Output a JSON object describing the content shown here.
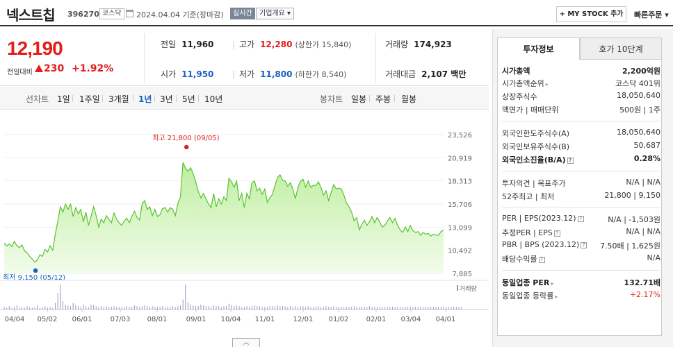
{
  "header": {
    "name": "넥스트칩",
    "code": "396270",
    "market": "코스닥",
    "as_of": "2024.04.04  기준(장마감)",
    "realtime": "실시간",
    "company_btn": "기업개요 ▾",
    "mystock_btn": "+ MY STOCK 추가",
    "quick_order": "빠른주문 ▾"
  },
  "price": {
    "current": "12,190",
    "diff_label": "전일대비",
    "diff_value": "230",
    "diff_rate": "+1.92%",
    "prev_close_label": "전일",
    "prev_close": "11,960",
    "open_label": "시가",
    "open": "11,950",
    "high_label": "고가",
    "high": "12,280",
    "upper_limit": "(상한가 15,840)",
    "low_label": "저가",
    "low": "11,800",
    "lower_limit": "(하한가 8,540)",
    "volume_label": "거래량",
    "volume": "174,923",
    "trade_value_label": "거래대금",
    "trade_value": "2,107 백만"
  },
  "chart_tabs": {
    "line_label": "선차트",
    "line_periods": [
      "1일",
      "1주일",
      "3개월",
      "1년",
      "3년",
      "5년",
      "10년"
    ],
    "active": "1년",
    "candle_label": "봉차트",
    "candle_periods": [
      "일봉",
      "주봉",
      "월봉"
    ]
  },
  "chart_data": {
    "type": "area",
    "y_ticks": [
      "23,526",
      "20,919",
      "18,313",
      "15,706",
      "13,099",
      "10,492",
      "7,885"
    ],
    "ylim": [
      7885,
      23526
    ],
    "x_ticks": [
      "04/04",
      "05/02",
      "06/01",
      "07/03",
      "08/01",
      "09/01",
      "10/04",
      "11/01",
      "12/01",
      "01/02",
      "02/01",
      "03/04",
      "04/01"
    ],
    "max_label": "최고 21,800 (09/05)",
    "min_label": "최저 9,150 (05/12)",
    "volume_legend": "거래량",
    "series": [
      {
        "values": [
          11300,
          11000,
          11200,
          10900,
          11500,
          11000,
          10800,
          11100,
          10400,
          10200,
          9800,
          9500,
          9150,
          9400,
          10000,
          9800,
          10600,
          10300,
          11000,
          10500,
          12300,
          13800,
          15400,
          14800,
          15700,
          15100,
          15700,
          14300,
          15300,
          14600,
          15100,
          13700,
          14800,
          13300,
          14300,
          15400,
          14400,
          13100,
          14000,
          13600,
          14400,
          14000,
          13600,
          14700,
          14000,
          13600,
          13300,
          13800,
          14100,
          13600,
          14300,
          14900,
          14200,
          13900,
          15700,
          16100,
          15100,
          15400,
          14400,
          15100,
          14300,
          14500,
          15200,
          15300,
          14800,
          15300,
          15100,
          14400,
          15800,
          16500,
          20400,
          19700,
          19400,
          19800,
          19100,
          18200,
          17100,
          16400,
          16900,
          16300,
          15700,
          15300,
          16900,
          15400,
          16300,
          15700,
          16500,
          16100,
          18600,
          18200,
          17600,
          18300,
          16100,
          16900,
          15300,
          16900,
          16300,
          18100,
          18300,
          17200,
          17500,
          16800,
          17400,
          15900,
          16400,
          16800,
          17800,
          18700,
          19000,
          18400,
          18300,
          17700,
          18100,
          17400,
          16300,
          17600,
          18300,
          18500,
          17600,
          18300,
          17600,
          17800,
          17800,
          18200,
          17600,
          16700,
          17200,
          16100,
          17000,
          17900,
          17400,
          17500,
          17400,
          16700,
          15800,
          15400,
          14800,
          13800,
          14200,
          12800,
          13400,
          13900,
          13300,
          13700,
          14300,
          13600,
          14200,
          13700,
          13100,
          13300,
          13800,
          14200,
          13600,
          14100,
          13300,
          12800,
          12500,
          13100,
          12600,
          13300,
          12700,
          12500,
          12600,
          12200,
          12500,
          12300,
          12400,
          12100,
          12300,
          12200,
          12190,
          12600,
          12800
        ]
      }
    ],
    "volume": [
      3,
      2,
      4,
      2,
      3,
      5,
      2,
      3,
      2,
      4,
      3,
      2,
      3,
      5,
      2,
      3,
      4,
      2,
      3,
      2,
      8,
      20,
      30,
      10,
      6,
      5,
      4,
      8,
      5,
      4,
      3,
      6,
      4,
      3,
      6,
      5,
      4,
      3,
      4,
      3,
      4,
      3,
      3,
      4,
      3,
      3,
      3,
      3,
      4,
      3,
      3,
      5,
      4,
      3,
      4,
      5,
      4,
      3,
      4,
      3,
      3,
      3,
      4,
      3,
      3,
      3,
      4,
      3,
      4,
      5,
      12,
      30,
      9,
      6,
      5,
      4,
      4,
      6,
      5,
      4,
      4,
      3,
      5,
      4,
      4,
      3,
      4,
      4,
      7,
      5,
      4,
      5,
      4,
      3,
      3,
      4,
      3,
      4,
      5,
      4,
      4,
      3,
      3,
      3,
      4,
      4,
      4,
      5,
      4,
      4,
      4,
      3,
      4,
      3,
      4,
      3,
      4,
      4,
      3,
      4,
      3,
      3,
      3,
      4,
      3,
      3,
      4,
      3,
      3,
      4,
      3,
      3,
      3,
      3,
      3,
      3,
      3,
      4,
      3,
      3,
      3,
      3,
      3,
      4,
      3,
      3,
      3,
      3,
      3,
      3,
      3,
      3,
      3,
      3,
      3,
      3,
      3,
      3,
      3,
      3,
      3,
      3,
      3,
      3,
      3,
      3,
      3,
      3,
      3,
      3,
      3,
      3,
      3,
      3,
      3,
      3,
      3,
      3,
      3,
      3
    ]
  },
  "side": {
    "tab_active": "투자정보",
    "tab_inactive": "호가 10단계",
    "rows": [
      {
        "l": "시가총액",
        "r": "2,200억원",
        "bold": true
      },
      {
        "l": "시가총액순위",
        "r": "코스닥 401위"
      },
      {
        "l": "상장주식수",
        "r": "18,050,640"
      },
      {
        "l": "액면가 | 매매단위",
        "r": "500원 | 1주"
      },
      {
        "l": "외국인한도주식수(A)",
        "r": "18,050,640"
      },
      {
        "l": "외국인보유주식수(B)",
        "r": "50,687"
      },
      {
        "l": "외국인소진율(B/A)",
        "r": "0.28%",
        "bold": true
      },
      {
        "l": "투자의견 | 목표주가",
        "r": "N/A | N/A"
      },
      {
        "l": "52주최고 | 최저",
        "r": "21,800 | 9,150"
      },
      {
        "l": "PER | EPS(2023.12)",
        "r": "N/A | -1,503원"
      },
      {
        "l": "추정PER | EPS",
        "r": "N/A | N/A"
      },
      {
        "l": "PBR | BPS (2023.12)",
        "r": "7.50배 | 1,625원"
      },
      {
        "l": "배당수익률",
        "r": "N/A"
      },
      {
        "l": "동일업종 PER",
        "r": "132.71배",
        "bold": true
      },
      {
        "l": "동일업종 등락률",
        "r": "+2.17%",
        "red": true
      }
    ]
  },
  "toggle": "︿",
  "colors": {
    "up": "#e41c1c",
    "down": "#1a5fc1",
    "area_line": "#57c32c",
    "area_fill": "#c8f0a8"
  }
}
